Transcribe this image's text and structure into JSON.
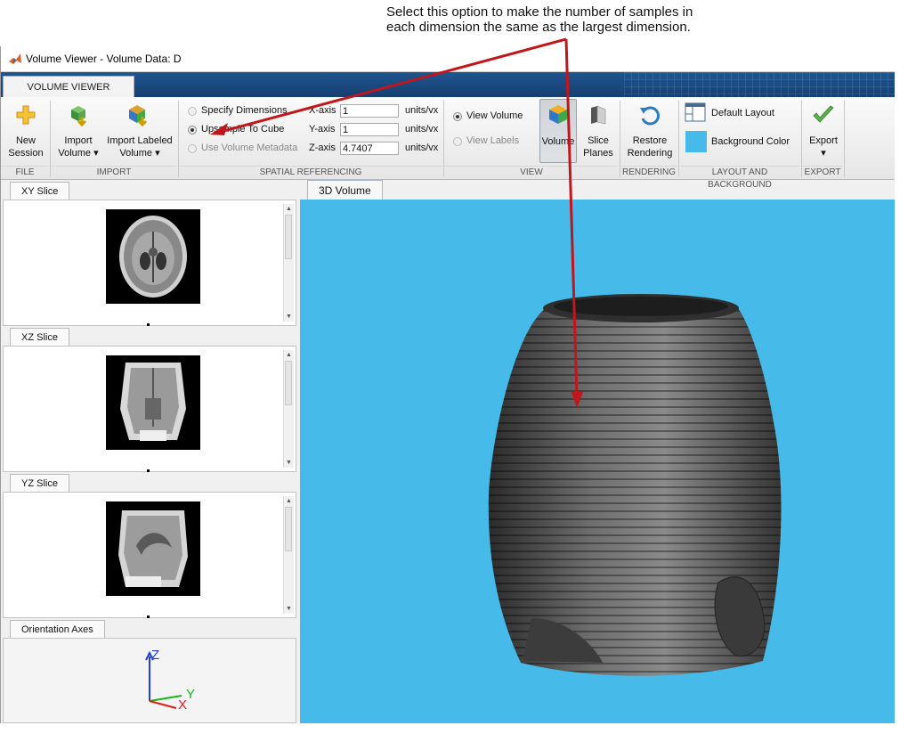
{
  "callout": {
    "line1": "Select this option to make the number of samples in",
    "line2": "each dimension the same as the largest dimension."
  },
  "window": {
    "title": "Volume Viewer - Volume Data: D"
  },
  "ribbon": {
    "tab_label": "VOLUME VIEWER",
    "file": {
      "section": "FILE",
      "new_session": [
        "New",
        "Session"
      ]
    },
    "import": {
      "section": "IMPORT",
      "import_volume": [
        "Import",
        "Volume ▾"
      ],
      "import_labeled": [
        "Import Labeled",
        "Volume ▾"
      ]
    },
    "spatial": {
      "section": "SPATIAL REFERENCING",
      "specify_dimensions": "Specify Dimensions",
      "upsample_to_cube": "Upsample To Cube",
      "use_volume_metadata": "Use Volume Metadata",
      "selected": "Upsample To Cube",
      "x_label": "X-axis",
      "x_value": "1",
      "y_label": "Y-axis",
      "y_value": "1",
      "z_label": "Z-axis",
      "z_value": "4.7407",
      "units": "units/vx"
    },
    "view": {
      "section": "VIEW",
      "view_volume": "View Volume",
      "view_labels": "View Labels",
      "volume_btn": "Volume",
      "slice_planes": [
        "Slice",
        "Planes"
      ]
    },
    "rendering": {
      "section": "RENDERING",
      "restore": [
        "Restore",
        "Rendering"
      ]
    },
    "layout": {
      "section": "LAYOUT AND BACKGROUND",
      "default_layout": "Default Layout",
      "background_color": "Background Color"
    },
    "export": {
      "section": "EXPORT",
      "export": "Export",
      "export_arrow": "▾"
    }
  },
  "panels": {
    "xy": "XY Slice",
    "xz": "XZ Slice",
    "yz": "YZ Slice",
    "orientation": "Orientation Axes"
  },
  "orientation_axes": {
    "x": "X",
    "y": "Y",
    "z": "Z"
  },
  "volume_tab": "3D Volume",
  "colors": {
    "ribbon_blue": "#1e4f87",
    "volume_bg": "#46bbe9",
    "annotation_arrow": "#c0161c"
  },
  "icons": {
    "new_session": "plus-icon",
    "import_volume": "cube-arrow-icon",
    "import_labeled": "labeled-cube-icon",
    "volume": "colored-cube-icon",
    "slice_planes": "slice-planes-icon",
    "restore": "restore-arrow-icon",
    "default_layout": "layout-grid-icon",
    "background_color": "color-swatch-icon",
    "export": "checkmark-icon"
  }
}
